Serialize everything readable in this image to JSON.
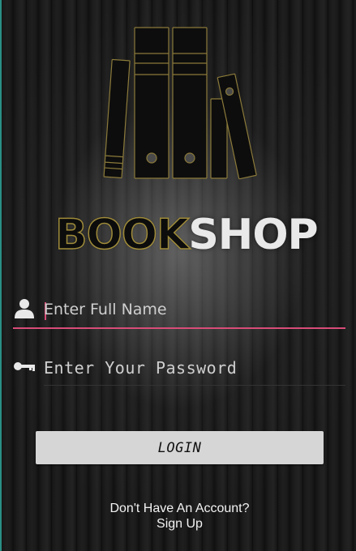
{
  "brand": {
    "part1": "BOOK",
    "part2": "SHOP"
  },
  "logo": {
    "icon": "books-icon"
  },
  "fields": {
    "name": {
      "icon": "user-icon",
      "placeholder": "Enter Full Name",
      "value": ""
    },
    "password": {
      "icon": "key-icon",
      "placeholder": "Enter Your Password",
      "value": ""
    }
  },
  "login": {
    "label": "LOGIN"
  },
  "signup": {
    "question": "Don't Have An Account?",
    "link": "Sign Up"
  },
  "colors": {
    "accent": "#d84c78",
    "button_bg": "#d6d6d6",
    "brand_outline": "#a08c3a",
    "side_border": "#2a8f86"
  }
}
